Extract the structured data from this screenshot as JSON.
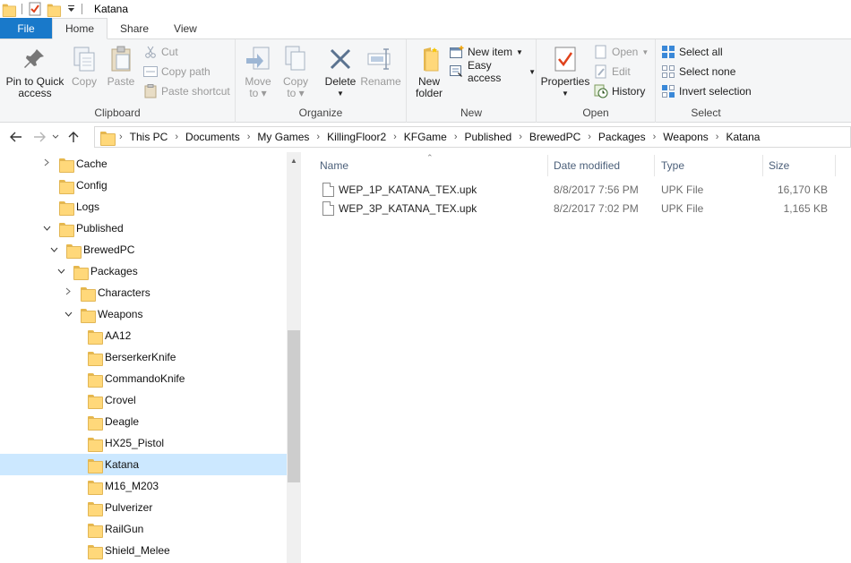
{
  "window": {
    "title": "Katana"
  },
  "tabs": [
    {
      "label": "File"
    },
    {
      "label": "Home"
    },
    {
      "label": "Share"
    },
    {
      "label": "View"
    }
  ],
  "ribbon": {
    "clipboard": {
      "label": "Clipboard",
      "pin": "Pin to Quick access",
      "pin_line1": "Pin to Quick",
      "pin_line2": "access",
      "copy": "Copy",
      "paste": "Paste",
      "cut": "Cut",
      "copy_path": "Copy path",
      "paste_shortcut": "Paste shortcut"
    },
    "organize": {
      "label": "Organize",
      "move_to": "Move to",
      "copy_to": "Copy to",
      "move_line1": "Move",
      "move_line2": "to",
      "copy_line1": "Copy",
      "copy_line2": "to",
      "delete": "Delete",
      "rename": "Rename"
    },
    "new": {
      "label": "New",
      "new_folder": "New folder",
      "new_folder_line1": "New",
      "new_folder_line2": "folder",
      "new_item": "New item",
      "easy_access": "Easy access"
    },
    "open": {
      "label": "Open",
      "properties": "Properties",
      "open": "Open",
      "edit": "Edit",
      "history": "History"
    },
    "select": {
      "label": "Select",
      "select_all": "Select all",
      "select_none": "Select none",
      "invert_selection": "Invert selection"
    }
  },
  "breadcrumb": [
    "This PC",
    "Documents",
    "My Games",
    "KillingFloor2",
    "KFGame",
    "Published",
    "BrewedPC",
    "Packages",
    "Weapons",
    "Katana"
  ],
  "tree": [
    {
      "label": "Cache",
      "expander": "right"
    },
    {
      "label": "Config",
      "expander": ""
    },
    {
      "label": "Logs",
      "expander": ""
    },
    {
      "label": "Published",
      "expander": "down"
    },
    {
      "label": "BrewedPC",
      "expander": "down"
    },
    {
      "label": "Packages",
      "expander": "down"
    },
    {
      "label": "Characters",
      "expander": "right"
    },
    {
      "label": "Weapons",
      "expander": "down"
    },
    {
      "label": "AA12",
      "expander": ""
    },
    {
      "label": "BerserkerKnife",
      "expander": ""
    },
    {
      "label": "CommandoKnife",
      "expander": ""
    },
    {
      "label": "Crovel",
      "expander": ""
    },
    {
      "label": "Deagle",
      "expander": ""
    },
    {
      "label": "HX25_Pistol",
      "expander": ""
    },
    {
      "label": "Katana",
      "expander": "",
      "selected": true
    },
    {
      "label": "M16_M203",
      "expander": ""
    },
    {
      "label": "Pulverizer",
      "expander": ""
    },
    {
      "label": "RailGun",
      "expander": ""
    },
    {
      "label": "Shield_Melee",
      "expander": ""
    }
  ],
  "columns": [
    "Name",
    "Date modified",
    "Type",
    "Size"
  ],
  "files": [
    {
      "name": "WEP_1P_KATANA_TEX.upk",
      "date": "8/8/2017 7:56 PM",
      "type": "UPK File",
      "size": "16,170 KB"
    },
    {
      "name": "WEP_3P_KATANA_TEX.upk",
      "date": "8/2/2017 7:02 PM",
      "type": "UPK File",
      "size": "1,165 KB"
    }
  ],
  "colors": {
    "accent": "#1979ca",
    "selection": "#cce8ff",
    "folder": "#ffd87a"
  }
}
